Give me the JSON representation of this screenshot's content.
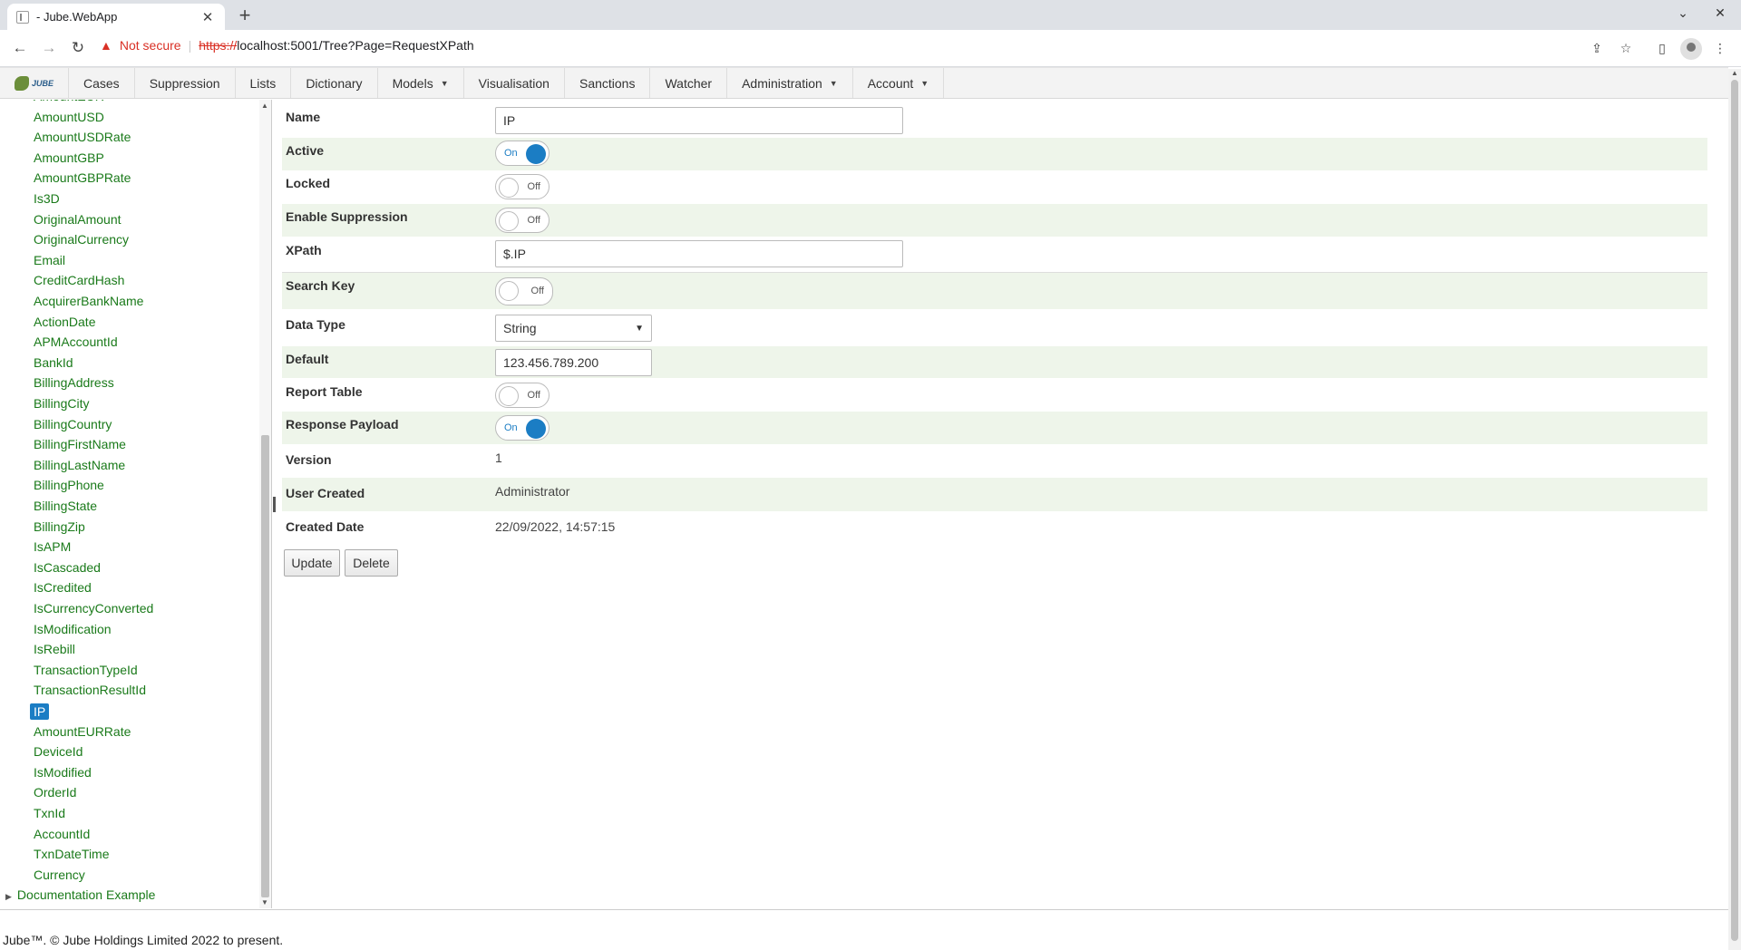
{
  "browser": {
    "tab_title": "- Jube.WebApp",
    "new_tab": "+",
    "close": "✕",
    "not_secure": "Not secure",
    "url_scheme": "https://",
    "url_rest": "localhost:5001/Tree?Page=RequestXPath"
  },
  "menu": {
    "logo": "JUBE",
    "items": [
      {
        "label": "Cases",
        "dropdown": false
      },
      {
        "label": "Suppression",
        "dropdown": false
      },
      {
        "label": "Lists",
        "dropdown": false
      },
      {
        "label": "Dictionary",
        "dropdown": false
      },
      {
        "label": "Models",
        "dropdown": true
      },
      {
        "label": "Visualisation",
        "dropdown": false
      },
      {
        "label": "Sanctions",
        "dropdown": false
      },
      {
        "label": "Watcher",
        "dropdown": false
      },
      {
        "label": "Administration",
        "dropdown": true
      },
      {
        "label": "Account",
        "dropdown": true
      }
    ]
  },
  "tree": {
    "items": [
      "AmountEUR",
      "AmountUSD",
      "AmountUSDRate",
      "AmountGBP",
      "AmountGBPRate",
      "Is3D",
      "OriginalAmount",
      "OriginalCurrency",
      "Email",
      "CreditCardHash",
      "AcquirerBankName",
      "ActionDate",
      "APMAccountId",
      "BankId",
      "BillingAddress",
      "BillingCity",
      "BillingCountry",
      "BillingFirstName",
      "BillingLastName",
      "BillingPhone",
      "BillingState",
      "BillingZip",
      "IsAPM",
      "IsCascaded",
      "IsCredited",
      "IsCurrencyConverted",
      "IsModification",
      "IsRebill",
      "TransactionTypeId",
      "TransactionResultId",
      "IP",
      "AmountEURRate",
      "DeviceId",
      "IsModified",
      "OrderId",
      "TxnId",
      "AccountId",
      "TxnDateTime",
      "Currency"
    ],
    "selected": "IP",
    "root_next": "Documentation Example"
  },
  "form": {
    "name_label": "Name",
    "name_value": "IP",
    "active_label": "Active",
    "active_state": "On",
    "locked_label": "Locked",
    "locked_state": "Off",
    "suppression_label": "Enable Suppression",
    "suppression_state": "Off",
    "xpath_label": "XPath",
    "xpath_value": "$.IP",
    "searchkey_label": "Search Key",
    "searchkey_state": "Off",
    "datatype_label": "Data Type",
    "datatype_value": "String",
    "default_label": "Default",
    "default_value": "123.456.789.200",
    "reporttable_label": "Report Table",
    "reporttable_state": "Off",
    "responsepayload_label": "Response Payload",
    "responsepayload_state": "On",
    "version_label": "Version",
    "version_value": "1",
    "usercreated_label": "User Created",
    "usercreated_value": "Administrator",
    "createddate_label": "Created Date",
    "createddate_value": "22/09/2022, 14:57:15",
    "update_button": "Update",
    "delete_button": "Delete"
  },
  "footer": "Jube™. © Jube Holdings Limited 2022 to present.",
  "colors": {
    "accent": "#1b7dc4",
    "tree_text": "#1a7a1a",
    "alt_row": "#eef5ea",
    "warning": "#d93025"
  }
}
